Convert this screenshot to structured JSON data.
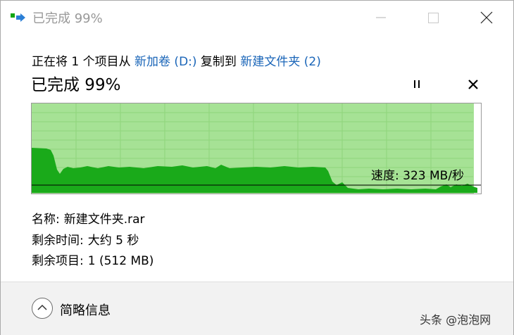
{
  "window": {
    "title": "已完成 99%",
    "icon": "copy-progress-icon",
    "controls": [
      "minimize-icon",
      "maximize-icon",
      "close-icon"
    ]
  },
  "transfer": {
    "line_prefix": "正在将 1 个项目从 ",
    "source": "新加卷 (D:)",
    "line_middle": " 复制到 ",
    "destination": "新建文件夹 (2)",
    "progress_text": "已完成 99%",
    "progress_percent": 99,
    "pause_icon": "pause-icon",
    "cancel_icon": "cancel-icon"
  },
  "chart_data": {
    "type": "area",
    "speed_label": "速度: 323 MB/秒",
    "progress_fraction": 0.99,
    "fill_color": "#1aaa1a",
    "background_color": "#a6e295",
    "grid": true
  },
  "details": {
    "name_label": "名称:",
    "name_value": "新建文件夹.rar",
    "time_label": "剩余时间:",
    "time_value": "大约 5 秒",
    "items_label": "剩余项目:",
    "items_value": "1 (512 MB)"
  },
  "footer": {
    "toggle_label": "简略信息",
    "toggle_icon": "chevron-up-icon"
  },
  "watermark": "头条 @泡泡网",
  "colors": {
    "link": "#1a65b8",
    "title_inactive": "#999999",
    "footer_bg": "#f2f2f2"
  }
}
